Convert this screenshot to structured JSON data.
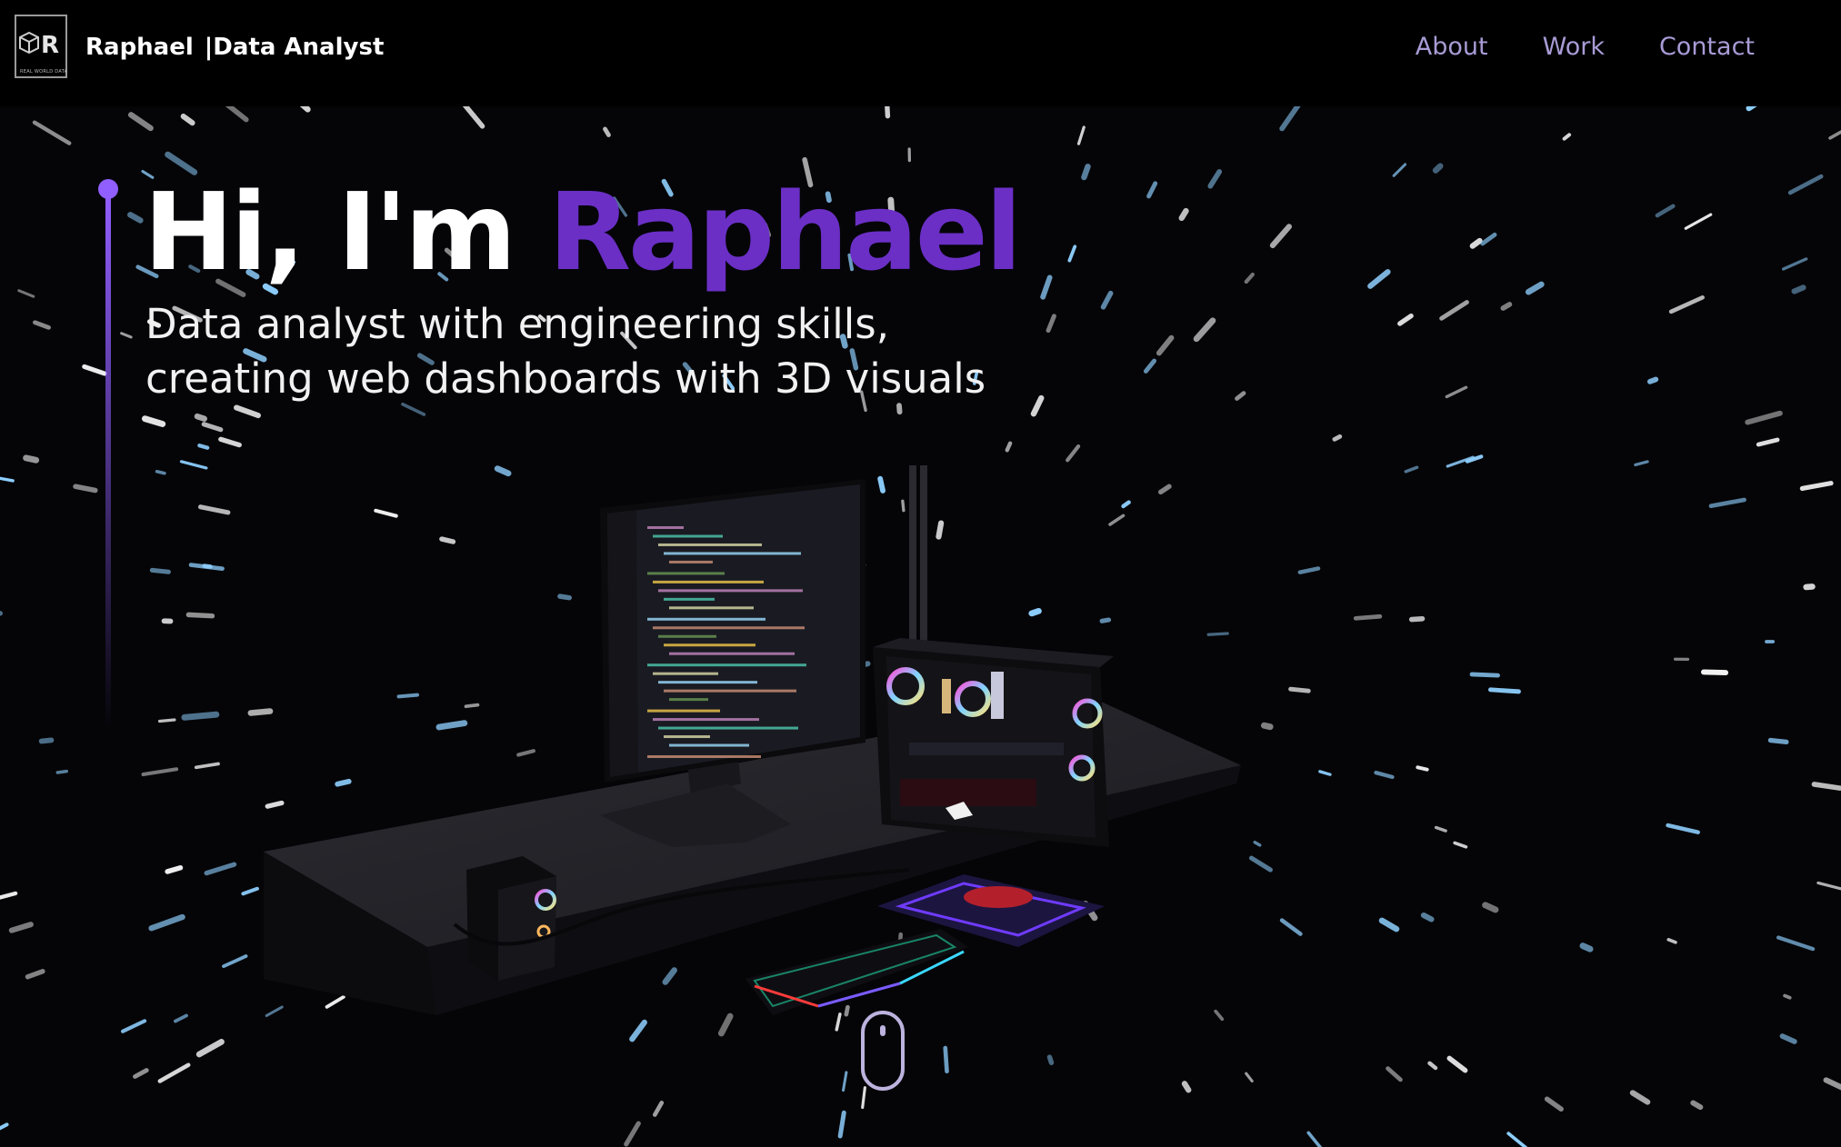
{
  "nav": {
    "logo_letter": "R",
    "logo_tagline": "REAL WORLD DATA",
    "brand_name": "Raphael",
    "brand_role": "|Data Analyst",
    "links": [
      {
        "label": "About"
      },
      {
        "label": "Work"
      },
      {
        "label": "Contact"
      }
    ]
  },
  "hero": {
    "greeting": "Hi, I'm ",
    "name": "Raphael",
    "subtitle_line1": "Data analyst with engineering skills,",
    "subtitle_line2": "creating web dashboards with 3D visuals"
  },
  "colors": {
    "accent": "#6b2fc6",
    "timeline": "#915eff",
    "nav_link": "#a99bd6",
    "background": "#050508"
  },
  "icons": {
    "logo": "cube-logo-icon",
    "scroll": "mouse-scroll-icon"
  }
}
